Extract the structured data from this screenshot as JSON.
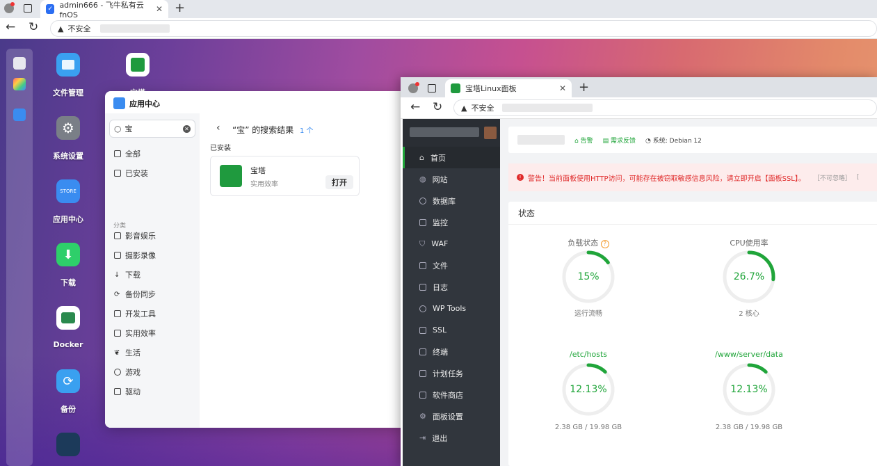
{
  "outer_browser": {
    "tab_title": "admin666 - 飞牛私有云fnOS",
    "not_secure": "不安全"
  },
  "desktop": {
    "icons": [
      {
        "label": "文件管理",
        "icon": "folder-icon",
        "color": "#3aa0f0"
      },
      {
        "label": "系统设置",
        "icon": "gear-icon",
        "color": "#7a7f87"
      },
      {
        "label": "应用中心",
        "icon": "store-icon",
        "color": "#3a8cf0"
      },
      {
        "label": "下载",
        "icon": "download-icon",
        "color": "#2ecf6a"
      },
      {
        "label": "Docker",
        "icon": "docker-icon",
        "color": "#ffffff"
      },
      {
        "label": "备份",
        "icon": "backup-icon",
        "color": "#3aa0f0"
      }
    ],
    "baota_icon_label": "宝塔"
  },
  "app_center": {
    "title": "应用中心",
    "search_value": "宝",
    "nav_top": [
      "全部",
      "已安装"
    ],
    "category_header": "分类",
    "categories": [
      "影音娱乐",
      "摄影录像",
      "下载",
      "备份同步",
      "开发工具",
      "实用效率",
      "生活",
      "游戏",
      "驱动"
    ],
    "results_title": "“宝” 的搜索结果",
    "results_count": "1 个",
    "installed_header": "已安装",
    "result": {
      "name": "宝塔",
      "category": "实用效率",
      "action": "打开"
    }
  },
  "baota_browser": {
    "tab_title": "宝塔Linux面板",
    "not_secure": "不安全",
    "menu": [
      "首页",
      "网站",
      "数据库",
      "监控",
      "WAF",
      "文件",
      "日志",
      "WP Tools",
      "SSL",
      "终端",
      "计划任务",
      "软件商店",
      "面板设置",
      "退出"
    ],
    "header": {
      "alert": "告警",
      "feedback": "需求反馈",
      "system": "系统: Debian 12"
    },
    "warning": {
      "text": "警告！当前面板使用HTTP访问，可能存在被窃取敏感信息风险，请立即开启【面板SSL】。",
      "ignore": "［不可忽略］",
      "extra": "["
    },
    "status_title": "状态",
    "gauges": [
      {
        "label": "负载状态",
        "value": "15%",
        "percent": 15,
        "sub": "运行流畅",
        "help": "?"
      },
      {
        "label": "CPU使用率",
        "value": "26.7%",
        "percent": 26.7,
        "sub": "2 核心"
      },
      {
        "label": "/etc/hosts",
        "value": "12.13%",
        "percent": 12.13,
        "sub": "2.38 GB / 19.98 GB"
      },
      {
        "label": "/www/server/data",
        "value": "12.13%",
        "percent": 12.13,
        "sub": "2.38 GB / 19.98 GB"
      }
    ]
  }
}
